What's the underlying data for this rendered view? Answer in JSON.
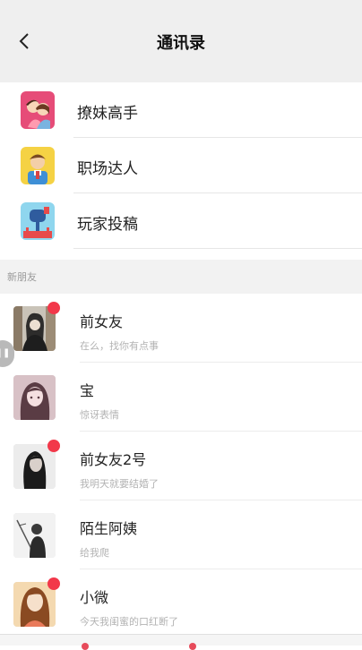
{
  "header": {
    "title": "通讯录",
    "back_icon": "chevron-left-icon"
  },
  "categories": [
    {
      "label": "撩妹高手",
      "icon": "couple-icon"
    },
    {
      "label": "职场达人",
      "icon": "office-worker-icon"
    },
    {
      "label": "玩家投稿",
      "icon": "mailbox-icon"
    }
  ],
  "section": {
    "label": "新朋友"
  },
  "friends": [
    {
      "name": "前女友",
      "message": "在么，找你有点事",
      "unread": true
    },
    {
      "name": "宝",
      "message": "惊讶表情",
      "unread": false
    },
    {
      "name": "前女友2号",
      "message": "我明天就要结婚了",
      "unread": true
    },
    {
      "name": "陌生阿姨",
      "message": "给我爬",
      "unread": false
    },
    {
      "name": "小微",
      "message": "今天我闺蜜的口红断了",
      "unread": true
    }
  ],
  "colors": {
    "badge": "#f2384a",
    "header_bg": "#efefef",
    "section_bg": "#f2f2f2"
  }
}
